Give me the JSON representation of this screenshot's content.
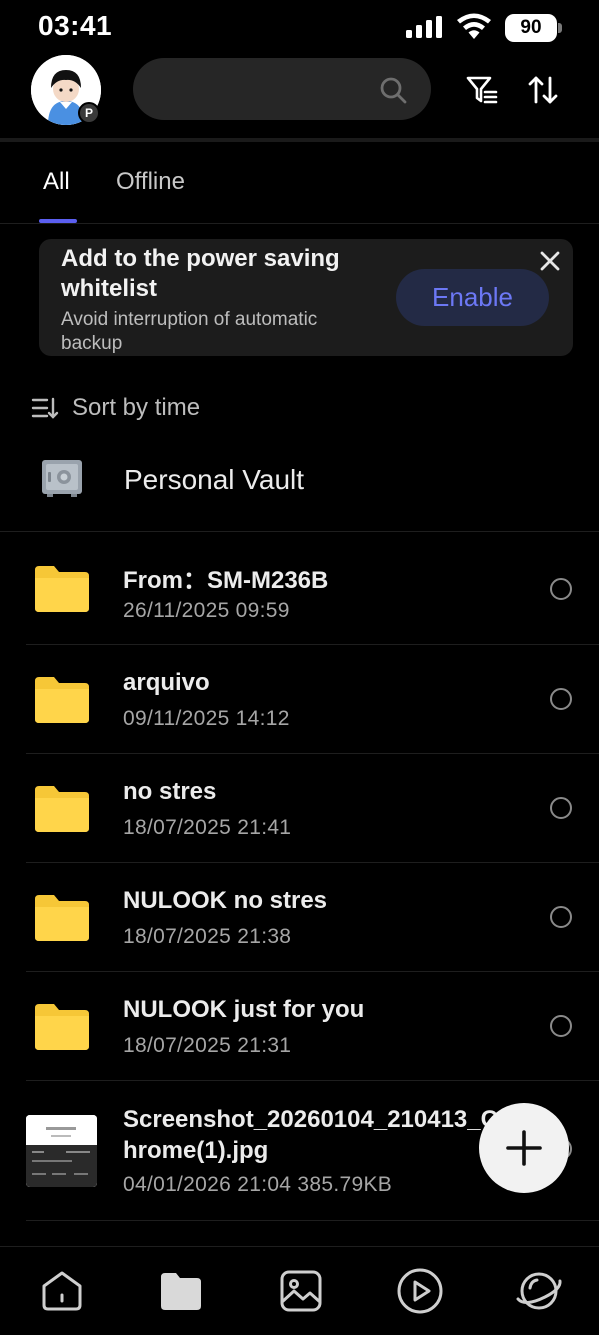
{
  "status_bar": {
    "time": "03:41",
    "battery": "90"
  },
  "header": {
    "avatar_badge": "P",
    "search_placeholder": ""
  },
  "tabs": [
    {
      "label": "All",
      "active": true
    },
    {
      "label": "Offline",
      "active": false
    }
  ],
  "banner": {
    "title": "Add to the power saving whitelist",
    "subtitle": "Avoid interruption of automatic backup",
    "button": "Enable"
  },
  "sort": {
    "label": "Sort by time"
  },
  "vault": {
    "label": "Personal Vault"
  },
  "items": [
    {
      "title": "From：SM-M236B",
      "meta": "26/11/2025  09:59",
      "type": "folder"
    },
    {
      "title": "arquivo",
      "meta": "09/11/2025  14:12",
      "type": "folder"
    },
    {
      "title": "no stres",
      "meta": "18/07/2025  21:41",
      "type": "folder"
    },
    {
      "title": "NULOOK no stres",
      "meta": "18/07/2025  21:38",
      "type": "folder"
    },
    {
      "title": "NULOOK just for you",
      "meta": "18/07/2025  21:31",
      "type": "folder"
    },
    {
      "title": "Screenshot_20260104_210413_C",
      "title_line2": "hrome(1).jpg",
      "meta": "04/01/2026  21:04   385.79KB",
      "type": "image"
    }
  ],
  "colors": {
    "accent": "#5b5ff0",
    "folder": "#ffd54a",
    "enable_text": "#6c78f5"
  },
  "bottom_nav": [
    "home-icon",
    "files-icon",
    "photos-icon",
    "video-icon",
    "discover-icon"
  ]
}
